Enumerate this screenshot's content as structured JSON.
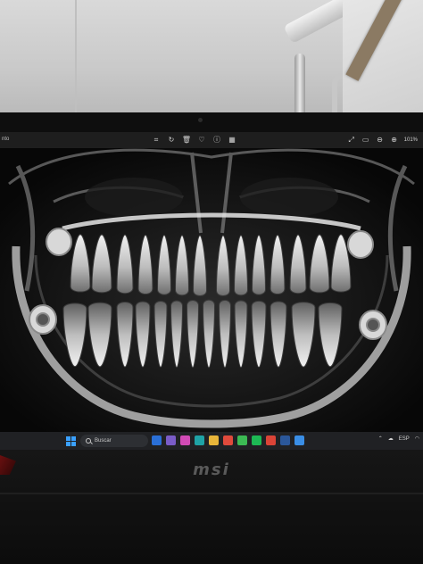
{
  "viewer": {
    "title_fragment": "nto",
    "zoom": "101%",
    "toolbar_icons": [
      "crop-icon",
      "rotate-icon",
      "delete-icon",
      "favorite-icon",
      "info-icon",
      "edit-icon"
    ],
    "right_icons": [
      "fullscreen-icon",
      "slideshow-icon",
      "zoom-out-icon",
      "zoom-in-icon"
    ]
  },
  "taskbar": {
    "search_placeholder": "Buscar",
    "apps": [
      {
        "name": "widgets-app",
        "color": "#2a6fd6"
      },
      {
        "name": "files-app",
        "color": "#7a5cc7"
      },
      {
        "name": "media-app",
        "color": "#d14bb6"
      },
      {
        "name": "edge-app",
        "color": "#1fa3a6"
      },
      {
        "name": "explorer-app",
        "color": "#e8b53a"
      },
      {
        "name": "store-app",
        "color": "#e04a3c"
      },
      {
        "name": "chrome-app",
        "color": "#3cba54"
      },
      {
        "name": "spotify-app",
        "color": "#1db954"
      },
      {
        "name": "chrome-profile-app",
        "color": "#db4437"
      },
      {
        "name": "word-app",
        "color": "#2b579a"
      },
      {
        "name": "photos-app",
        "color": "#3a8ee6"
      }
    ],
    "language": "ESP"
  },
  "laptop": {
    "brand": "msi"
  },
  "colors": {
    "xray_bone": "#dcdcdc",
    "xray_dark": "#0a0a0a",
    "taskbar": "#202124"
  }
}
